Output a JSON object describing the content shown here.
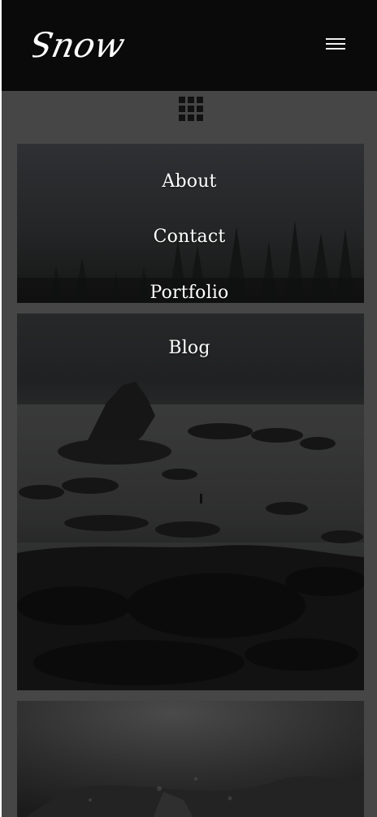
{
  "header": {
    "logo_text": "Snow",
    "menu_icon": "hamburger-icon"
  },
  "grid_toggle": {
    "icon": "grid-icon"
  },
  "nav": {
    "items": [
      {
        "label": "About"
      },
      {
        "label": "Contact"
      },
      {
        "label": "Portfolio"
      },
      {
        "label": "Blog"
      }
    ]
  },
  "tiles": [
    {
      "subject": "forest-photo"
    },
    {
      "subject": "rocky-coast-photo"
    },
    {
      "subject": "underwater-photo"
    }
  ],
  "colors": {
    "header_bg": "#0a0a0a",
    "page_bg": "#464646",
    "text": "#ffffff"
  }
}
